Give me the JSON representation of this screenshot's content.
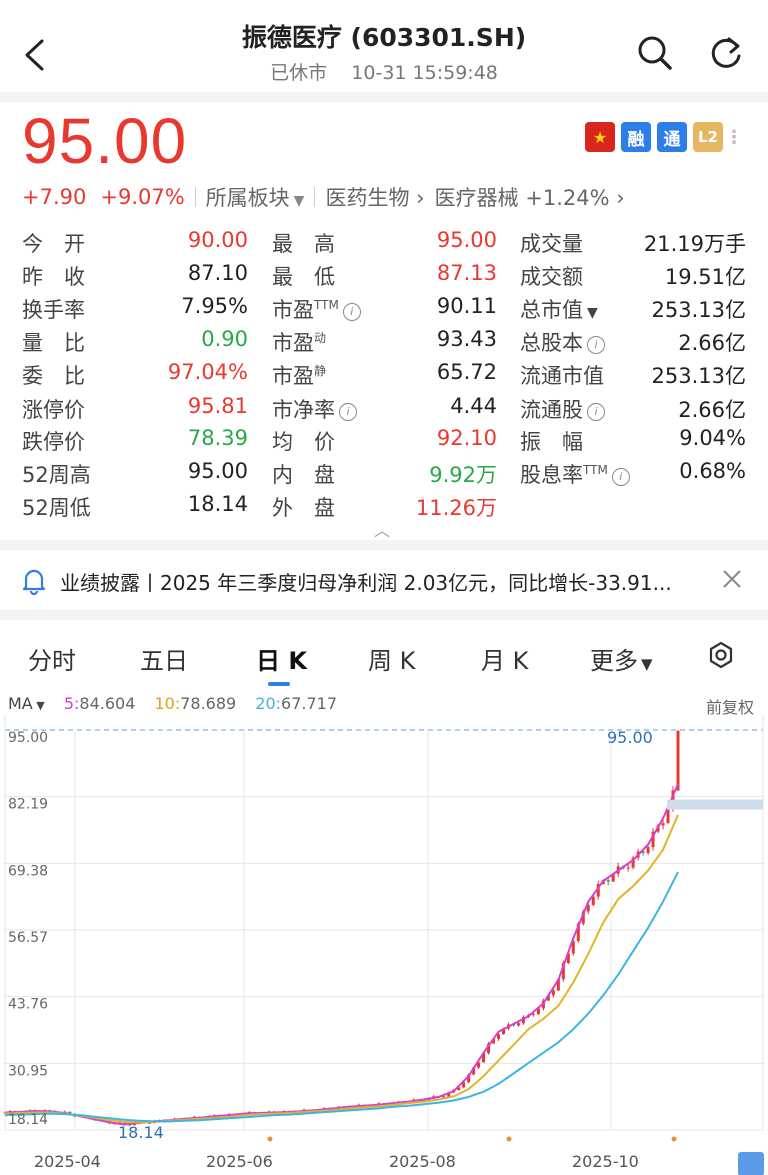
{
  "header": {
    "title": "振德医疗 (603301.SH)",
    "status": "已休市",
    "datetime": "10-31 15:59:48"
  },
  "quote": {
    "price": "95.00",
    "change": "+7.90",
    "change_pct": "+9.07%",
    "sector_label": "所属板块",
    "sector_path_1": "医药生物",
    "sector_path_2": "医疗器械",
    "sector_change": "+1.24%",
    "badges": {
      "rong": "融",
      "tong": "通",
      "l2": "L2"
    }
  },
  "stats": {
    "col1": [
      {
        "label": "今　开",
        "value": "90.00"
      },
      {
        "label": "昨　收",
        "value": "87.10"
      },
      {
        "label": "换手率",
        "value": "7.95%"
      },
      {
        "label": "量　比",
        "value": "0.90"
      },
      {
        "label": "委　比",
        "value": "97.04%"
      },
      {
        "label": "涨停价",
        "value": "95.81"
      },
      {
        "label": "跌停价",
        "value": "78.39"
      },
      {
        "label": "52周高",
        "value": "95.00"
      },
      {
        "label": "52周低",
        "value": "18.14"
      }
    ],
    "col2": [
      {
        "label": "最　高",
        "value": "95.00"
      },
      {
        "label": "最　低",
        "value": "87.13"
      },
      {
        "label": "市盈",
        "sup": "TTM",
        "value": "90.11"
      },
      {
        "label": "市盈",
        "sup": "动",
        "value": "93.43"
      },
      {
        "label": "市盈",
        "sup": "静",
        "value": "65.72"
      },
      {
        "label": "市净率",
        "value": "4.44"
      },
      {
        "label": "均　价",
        "value": "92.10"
      },
      {
        "label": "内　盘",
        "value": "9.92万"
      },
      {
        "label": "外　盘",
        "value": "11.26万"
      }
    ],
    "col3": [
      {
        "label": "成交量",
        "value": "21.19万手"
      },
      {
        "label": "成交额",
        "value": "19.51亿"
      },
      {
        "label": "总市值",
        "value": "253.13亿"
      },
      {
        "label": "总股本",
        "value": "2.66亿"
      },
      {
        "label": "流通市值",
        "value": "253.13亿"
      },
      {
        "label": "流通股",
        "value": "2.66亿"
      },
      {
        "label": "振　幅",
        "value": "9.04%"
      },
      {
        "label": "股息率",
        "sup": "TTM",
        "value": "0.68%"
      }
    ]
  },
  "notice": {
    "text": "业绩披露丨2025 年三季度归母净利润 2.03亿元，同比增长-33.91..."
  },
  "tabs": [
    "分时",
    "五日",
    "日 K",
    "周 K",
    "月 K",
    "更多"
  ],
  "ma": {
    "label": "MA",
    "ma5_key": "5:",
    "ma5": "84.604",
    "ma10_key": "10:",
    "ma10": "78.689",
    "ma20_key": "20:",
    "ma20": "67.717",
    "adjust": "前复权"
  },
  "colors": {
    "up": "#e8382f",
    "down": "#2aa846",
    "ma5": "#d63fd0",
    "ma10": "#e0b52a",
    "ma20": "#3fb4e0",
    "accent": "#2d7ee8"
  },
  "chart_data": {
    "type": "line",
    "title": "",
    "y_ticks": [
      "95.00",
      "82.19",
      "69.38",
      "56.57",
      "43.76",
      "30.95",
      "18.14"
    ],
    "x_ticks": [
      "2025-04",
      "2025-06",
      "2025-08",
      "2025-10"
    ],
    "ylim": [
      18.14,
      95.0
    ],
    "high_label": "95.00",
    "low_label": "18.14",
    "series": [
      {
        "name": "5",
        "values": [
          21.5,
          21.6,
          21.8,
          21.7,
          21.4,
          20.8,
          20.2,
          19.6,
          19.2,
          19.5,
          19.8,
          20.0,
          20.3,
          20.5,
          20.8,
          21.0,
          21.3,
          21.4,
          21.5,
          21.6,
          21.8,
          22.0,
          22.3,
          22.6,
          22.8,
          23.0,
          23.3,
          23.6,
          24.0,
          24.5,
          25.6,
          28.5,
          33.0,
          37.0,
          38.5,
          40.0,
          42.5,
          47.0,
          55.0,
          62.0,
          66.0,
          68.0,
          70.0,
          73.0,
          78.0,
          84.6
        ]
      },
      {
        "name": "10",
        "values": [
          21.3,
          21.4,
          21.5,
          21.5,
          21.3,
          20.9,
          20.5,
          20.0,
          19.7,
          19.6,
          19.7,
          19.9,
          20.1,
          20.3,
          20.5,
          20.7,
          21.0,
          21.2,
          21.3,
          21.4,
          21.6,
          21.8,
          22.0,
          22.3,
          22.5,
          22.7,
          23.0,
          23.3,
          23.6,
          24.0,
          24.6,
          26.0,
          28.5,
          31.5,
          34.5,
          37.5,
          39.5,
          42.0,
          46.5,
          52.0,
          58.0,
          62.5,
          65.0,
          68.0,
          72.0,
          78.7
        ]
      },
      {
        "name": "20",
        "values": [
          21.0,
          21.1,
          21.2,
          21.3,
          21.2,
          21.0,
          20.7,
          20.4,
          20.1,
          19.9,
          19.8,
          19.8,
          19.9,
          20.0,
          20.2,
          20.4,
          20.6,
          20.8,
          21.0,
          21.1,
          21.3,
          21.5,
          21.7,
          21.9,
          22.1,
          22.3,
          22.6,
          22.8,
          23.1,
          23.4,
          23.8,
          24.5,
          25.5,
          27.0,
          29.0,
          31.0,
          33.0,
          35.0,
          37.5,
          40.5,
          44.0,
          48.0,
          52.5,
          57.0,
          62.0,
          67.7
        ]
      }
    ]
  }
}
